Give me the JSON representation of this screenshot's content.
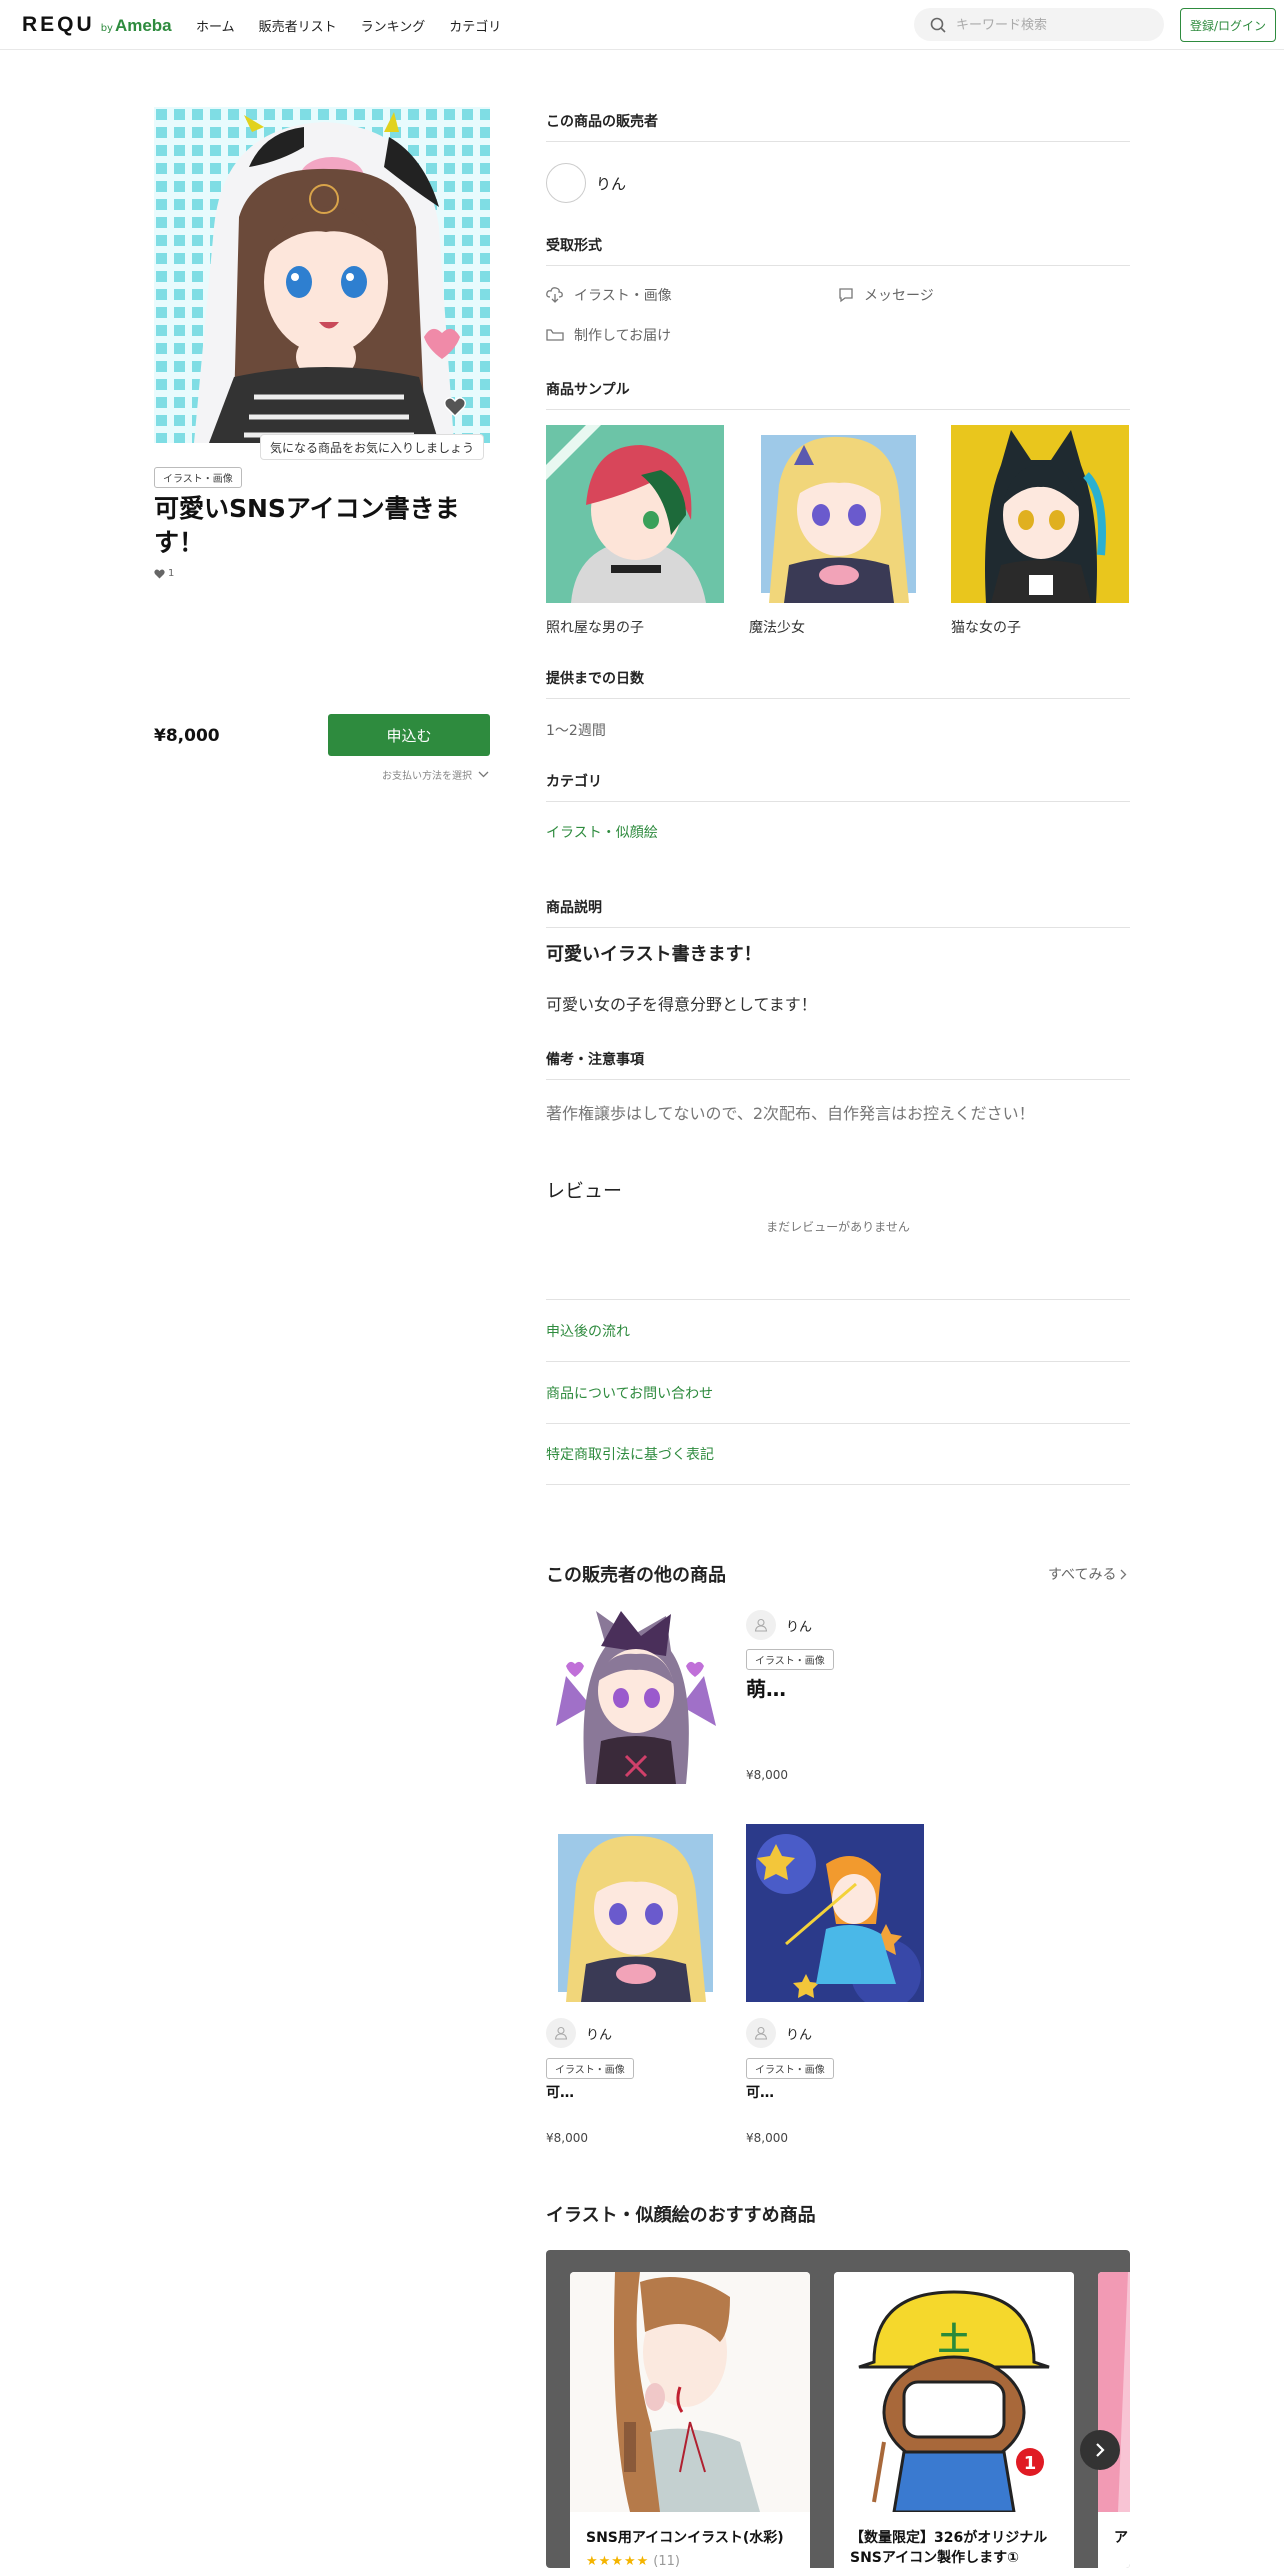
{
  "header": {
    "logo_main": "REQU",
    "logo_by": "by",
    "logo_sub": "Ameba",
    "nav": [
      "ホーム",
      "販売者リスト",
      "ランキング",
      "カテゴリ"
    ],
    "search_placeholder": "キーワード検索",
    "login_label": "登録/ログイン"
  },
  "product": {
    "fav_tooltip": "気になる商品をお気に入りしましょう",
    "category_tag": "イラスト・画像",
    "title": "可愛いSNSアイコン書きます！",
    "likes": "1",
    "price": "¥8,000",
    "apply_label": "申込む",
    "payment_label": "お支払い方法を選択"
  },
  "seller_section": {
    "heading": "この商品の販売者",
    "seller_name": "りん"
  },
  "receive_section": {
    "heading": "受取形式",
    "items": [
      "イラスト・画像",
      "メッセージ",
      "制作してお届け"
    ]
  },
  "samples_section": {
    "heading": "商品サンプル",
    "items": [
      {
        "caption": "照れ屋な男の子"
      },
      {
        "caption": "魔法少女"
      },
      {
        "caption": "猫な女の子"
      }
    ]
  },
  "delivery_section": {
    "heading": "提供までの日数",
    "value": "1〜2週間"
  },
  "category_section": {
    "heading": "カテゴリ",
    "value": "イラスト・似顔絵"
  },
  "description_section": {
    "heading": "商品説明",
    "lead": "可愛いイラスト書きます！",
    "body": "可愛い女の子を得意分野としてます！"
  },
  "notes_section": {
    "heading": "備考・注意事項",
    "body": "著作権譲歩はしてないので、2次配布、自作発言はお控えください！"
  },
  "reviews": {
    "heading": "レビュー",
    "empty": "まだレビューがありません"
  },
  "links": [
    "申込後の流れ",
    "商品についてお問い合わせ",
    "特定商取引法に基づく表記"
  ],
  "other_products": {
    "heading": "この販売者の他の商品",
    "see_all": "すべてみる",
    "items": [
      {
        "seller": "りん",
        "tag": "イラスト・画像",
        "title": "萌…",
        "price": "¥8,000"
      },
      {
        "seller": "りん",
        "tag": "イラスト・画像",
        "title": "可…",
        "price": "¥8,000"
      },
      {
        "seller": "りん",
        "tag": "イラスト・画像",
        "title": "可…",
        "price": "¥8,000"
      }
    ]
  },
  "recommended": {
    "heading": "イラスト・似顔絵のおすすめ商品",
    "cards": [
      {
        "title": "SNS用アイコンイラスト(水彩)",
        "stars": "★★★★★",
        "count": "(11)"
      },
      {
        "title": "【数量限定】326がオリジナルSNSアイコン製作します①",
        "stars": "",
        "count": ""
      },
      {
        "title": "ア ル",
        "stars": "",
        "count": ""
      }
    ]
  },
  "colors": {
    "accent": "#2e8b3e",
    "carousel_bg": "#5d5d5d"
  }
}
